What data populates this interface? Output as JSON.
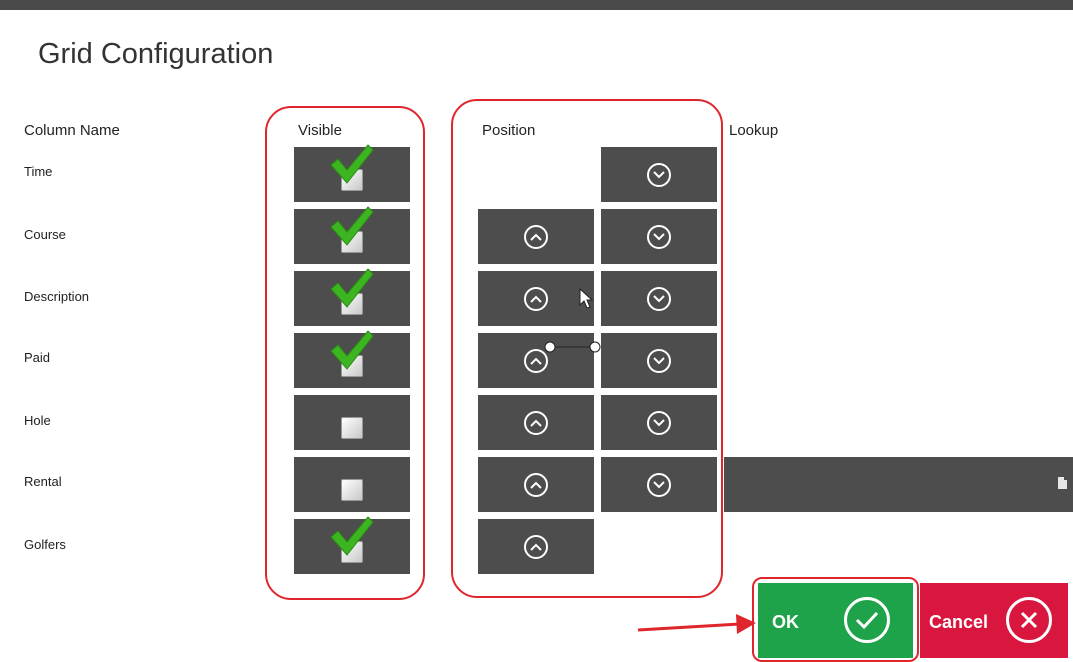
{
  "window": {
    "title": "Grid Configuration"
  },
  "headers": {
    "column_name": "Column Name",
    "visible": "Visible",
    "position": "Position",
    "lookup": "Lookup"
  },
  "rows": [
    {
      "name": "Time",
      "visible": true
    },
    {
      "name": "Course",
      "visible": true
    },
    {
      "name": "Description",
      "visible": true
    },
    {
      "name": "Paid",
      "visible": true
    },
    {
      "name": "Hole",
      "visible": false
    },
    {
      "name": "Rental",
      "visible": false
    },
    {
      "name": "Golfers",
      "visible": true
    }
  ],
  "buttons": {
    "ok": "OK",
    "cancel": "Cancel"
  },
  "icons": {
    "move_up": "chevron-up-circle-icon",
    "move_down": "chevron-down-circle-icon",
    "checked": "green-checkmark-icon",
    "lookup": "document-icon",
    "ok": "check-circle-icon",
    "cancel": "x-circle-icon"
  },
  "colors": {
    "tile": "#4d4d4d",
    "ok": "#1fa34a",
    "cancel": "#d8163e",
    "annotation": "#e0262d",
    "check": "#3cb521"
  }
}
